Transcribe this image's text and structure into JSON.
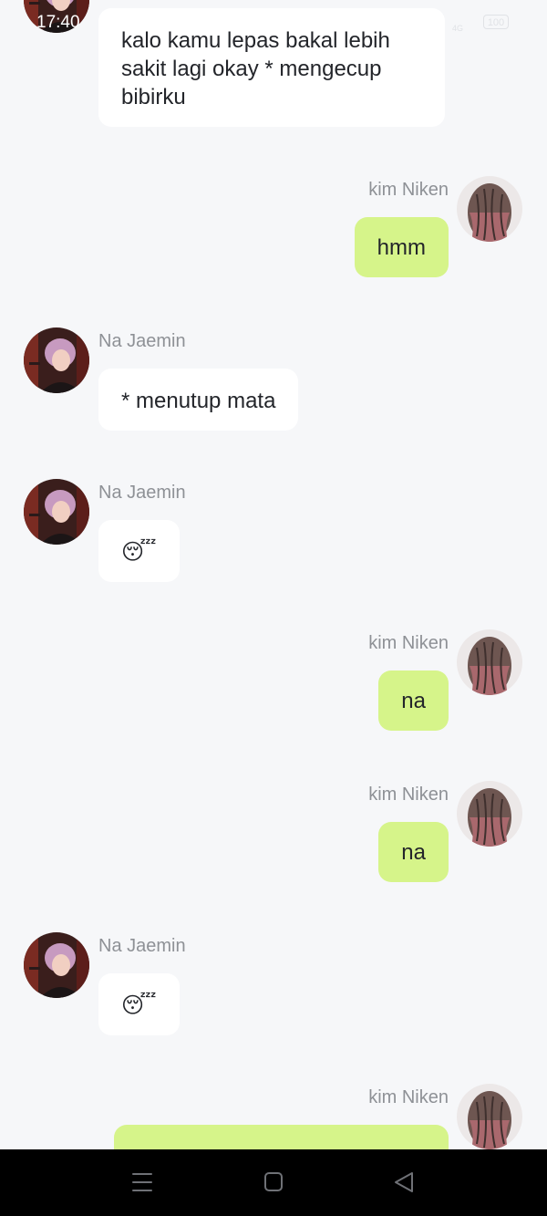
{
  "status_bar": {
    "time": "17:40",
    "signal": "4G",
    "battery": "100"
  },
  "contacts": {
    "self": {
      "name": "kim Niken"
    },
    "other": {
      "name": "Na Jaemin"
    }
  },
  "messages": [
    {
      "sender": "Na Jaemin",
      "side": "left",
      "text": "kalo kamu lepas bakal lebih sakit lagi okay * mengecup bibirku",
      "name_visible": false
    },
    {
      "sender": "kim Niken",
      "side": "right",
      "text": "hmm"
    },
    {
      "sender": "Na Jaemin",
      "side": "left",
      "text": "* menutup mata"
    },
    {
      "sender": "Na Jaemin",
      "side": "left",
      "text": "😴",
      "emoji": "sleeping-face"
    },
    {
      "sender": "kim Niken",
      "side": "right",
      "text": "na"
    },
    {
      "sender": "kim Niken",
      "side": "right",
      "text": "na"
    },
    {
      "sender": "Na Jaemin",
      "side": "left",
      "text": "😴",
      "emoji": "sleeping-face"
    },
    {
      "sender": "kim Niken",
      "side": "right",
      "text": "",
      "partial": true
    }
  ],
  "navigation": {
    "menu": "menu-icon",
    "home": "home-icon",
    "back": "back-icon"
  },
  "colors": {
    "background": "#f6f7f9",
    "incoming_bubble": "#ffffff",
    "outgoing_bubble": "#d6f48a",
    "name_text": "#8e9196",
    "nav_bar": "#000000"
  }
}
